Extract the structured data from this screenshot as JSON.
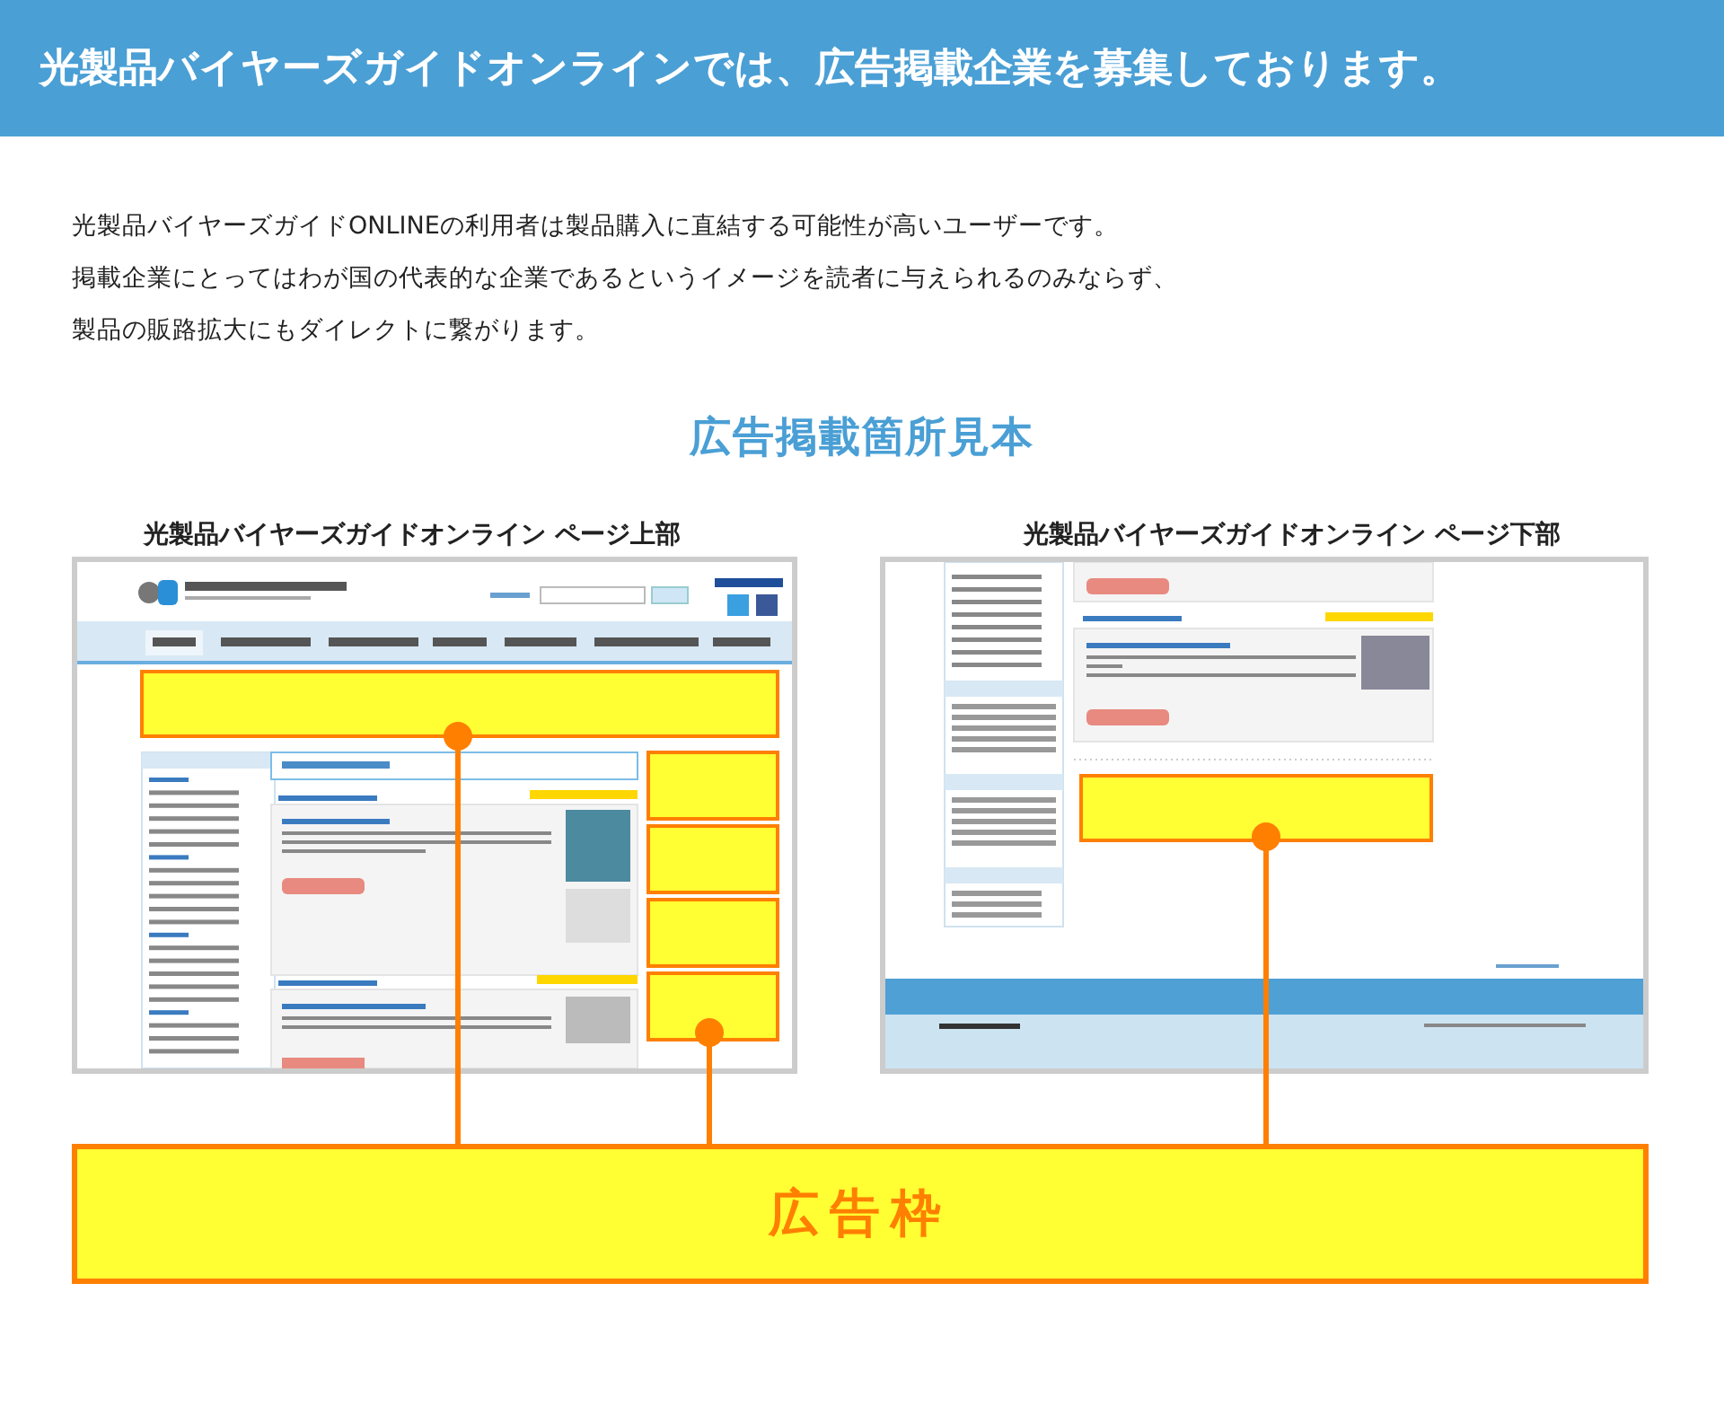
{
  "header": {
    "title": "光製品バイヤーズガイドオンラインでは、広告掲載企業を募集しております。"
  },
  "intro": [
    "光製品バイヤーズガイドONLINEの利用者は製品購入に直結する可能性が高いユーザーです。",
    "掲載企業にとってはわが国の代表的な企業であるというイメージを読者に与えられるのみならず、",
    "製品の販路拡大にもダイレクトに繋がります。"
  ],
  "section_heading": "広告掲載箇所見本",
  "samples": [
    {
      "label": "光製品バイヤーズガイドオンライン ページ上部",
      "kind": "top"
    },
    {
      "label": "光製品バイヤーズガイドオンライン ページ下部",
      "kind": "bottom"
    }
  ],
  "ad_frame": {
    "label": "広告枠"
  }
}
